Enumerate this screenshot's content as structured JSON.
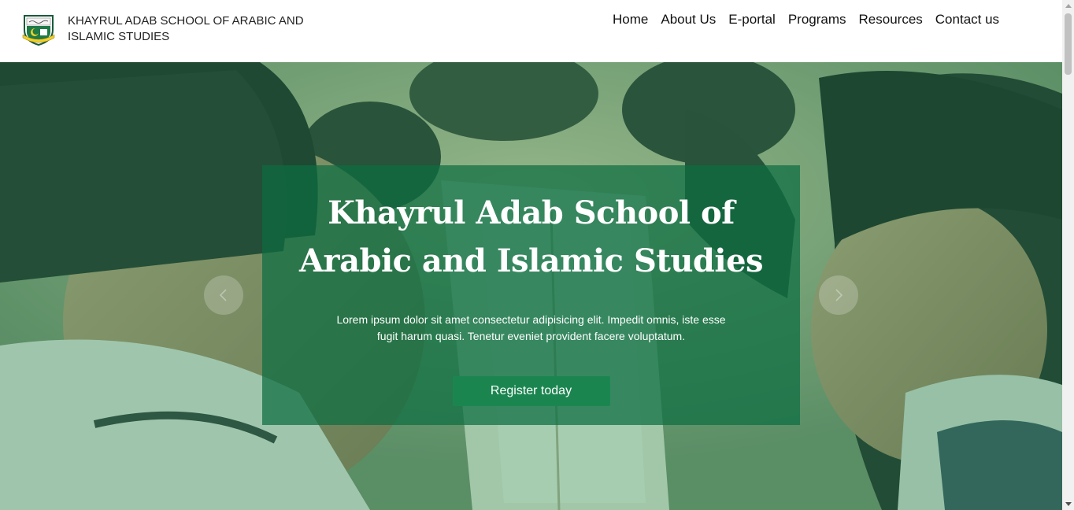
{
  "header": {
    "logo_icon": "school-crest-icon",
    "brand_name": "KHAYRUL ADAB SCHOOL OF ARABIC AND ISLAMIC STUDIES"
  },
  "nav": {
    "items": [
      {
        "label": "Home"
      },
      {
        "label": "About Us"
      },
      {
        "label": "E-portal"
      },
      {
        "label": "Programs"
      },
      {
        "label": "Resources"
      },
      {
        "label": "Contact us"
      }
    ]
  },
  "hero": {
    "title": "Khayrul Adab School of Arabic and Islamic Studies",
    "description": "Lorem ipsum dolor sit amet consectetur adipisicing elit. Impedit omnis, iste esse fugit harum quasi. Tenetur eveniet provident facere voluptatum.",
    "cta_label": "Register today",
    "prev_icon": "chevron-left-icon",
    "next_icon": "chevron-right-icon",
    "background_image": "students-reading-quran-photo"
  },
  "colors": {
    "brand_green": "#0c6e41",
    "button_green": "#1b8550",
    "nav_text": "#111111"
  }
}
